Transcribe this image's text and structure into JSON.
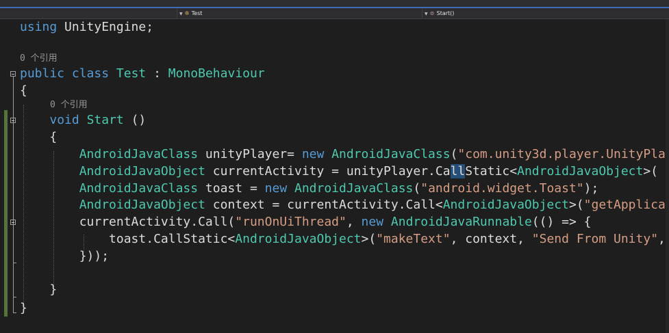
{
  "navbar": {
    "class_icon": "class-icon",
    "class_label": "Test",
    "member_icon": "method-icon",
    "member_label": "Start()"
  },
  "editor": {
    "lenses": {
      "class_refs": "0 个引用",
      "method_refs": "0 个引用"
    },
    "lines": [
      [
        [
          "kw",
          "using"
        ],
        [
          "pl",
          " UnityEngine;"
        ]
      ],
      [
        [
          "kw",
          "public"
        ],
        [
          "pl",
          " "
        ],
        [
          "kw",
          "class"
        ],
        [
          "pl",
          " "
        ],
        [
          "ty",
          "Test"
        ],
        [
          "pl",
          " : "
        ],
        [
          "ty",
          "MonoBehaviour"
        ]
      ],
      [
        [
          "pl",
          "{"
        ]
      ],
      [
        [
          "pl",
          "    "
        ],
        [
          "kw",
          "void"
        ],
        [
          "pl",
          " "
        ],
        [
          "ty",
          "Start"
        ],
        [
          "pl",
          " ()"
        ]
      ],
      [
        [
          "pl",
          "    {"
        ]
      ],
      [
        [
          "pl",
          "        "
        ],
        [
          "ty",
          "AndroidJavaClass"
        ],
        [
          "pl",
          " unityPlayer= "
        ],
        [
          "kw",
          "new"
        ],
        [
          "pl",
          " "
        ],
        [
          "ty",
          "AndroidJavaClass"
        ],
        [
          "pl",
          "("
        ],
        [
          "st",
          "\"com.unity3d.player.UnityPla"
        ]
      ],
      [
        [
          "pl",
          "        "
        ],
        [
          "ty",
          "AndroidJavaObject"
        ],
        [
          "pl",
          " currentActivity = unityPlayer.Ca"
        ],
        [
          "hl",
          "ll"
        ],
        [
          "pl",
          "Static<"
        ],
        [
          "ty",
          "AndroidJavaObject"
        ],
        [
          "pl",
          ">("
        ]
      ],
      [
        [
          "pl",
          "        "
        ],
        [
          "ty",
          "AndroidJavaClass"
        ],
        [
          "pl",
          " toast = "
        ],
        [
          "kw",
          "new"
        ],
        [
          "pl",
          " "
        ],
        [
          "ty",
          "AndroidJavaClass"
        ],
        [
          "pl",
          "("
        ],
        [
          "st",
          "\"android.widget.Toast\""
        ],
        [
          "pl",
          ");"
        ]
      ],
      [
        [
          "pl",
          "        "
        ],
        [
          "ty",
          "AndroidJavaObject"
        ],
        [
          "pl",
          " context = currentActivity.Call<"
        ],
        [
          "ty",
          "AndroidJavaObject"
        ],
        [
          "pl",
          ">("
        ],
        [
          "st",
          "\"getApplica"
        ]
      ],
      [
        [
          "pl",
          "        currentActivity.Call("
        ],
        [
          "st",
          "\"runOnUiThread\""
        ],
        [
          "pl",
          ", "
        ],
        [
          "kw",
          "new"
        ],
        [
          "pl",
          " "
        ],
        [
          "ty",
          "AndroidJavaRunnable"
        ],
        [
          "pl",
          "(() => {"
        ]
      ],
      [
        [
          "pl",
          "            toast.CallStatic<"
        ],
        [
          "ty",
          "AndroidJavaObject"
        ],
        [
          "pl",
          ">("
        ],
        [
          "st",
          "\"makeText\""
        ],
        [
          "pl",
          ", context, "
        ],
        [
          "st",
          "\"Send From Unity\""
        ],
        [
          "pl",
          ","
        ]
      ],
      [
        [
          "pl",
          "        }));"
        ]
      ],
      [
        [
          "pl",
          "    }"
        ]
      ],
      [
        [
          "pl",
          "}"
        ]
      ]
    ]
  }
}
